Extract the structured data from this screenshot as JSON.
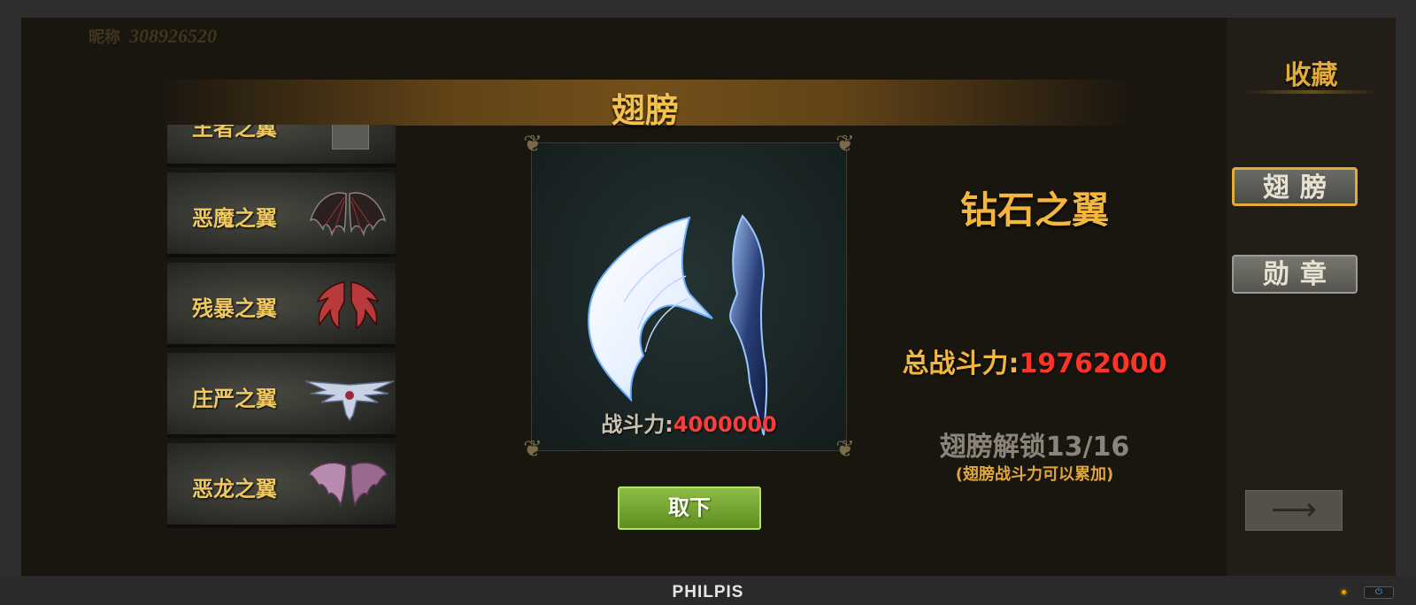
{
  "hud": {
    "name": "昵称",
    "id": "308926520"
  },
  "title": "翅膀",
  "wing_list": [
    {
      "label": "王者之翼",
      "icon": "locked-box"
    },
    {
      "label": "恶魔之翼",
      "icon": "demon-wings-icon"
    },
    {
      "label": "残暴之翼",
      "icon": "brutal-wings-icon"
    },
    {
      "label": "庄严之翼",
      "icon": "solemn-wings-icon"
    },
    {
      "label": "恶龙之翼",
      "icon": "dragon-wings-icon"
    }
  ],
  "preview": {
    "power_label": "战斗力:",
    "power_value": "4000000"
  },
  "take_off_label": "取下",
  "detail": {
    "name": "钻石之翼",
    "total_power_label": "总战斗力:",
    "total_power_value": "19762000",
    "unlock_text": "翅膀解锁13/16",
    "unlock_note": "(翅膀战斗力可以累加)"
  },
  "sidebar": {
    "title": "收藏",
    "tabs": [
      {
        "label": "翅膀",
        "active": true
      },
      {
        "label": "勋章",
        "active": false
      }
    ],
    "arrow_icon": "right-arrow-icon"
  },
  "monitor": {
    "brand": "PHILPIS"
  },
  "colors": {
    "gold": "#f2b73c",
    "red": "#ff3326",
    "green": "#7aa834"
  }
}
